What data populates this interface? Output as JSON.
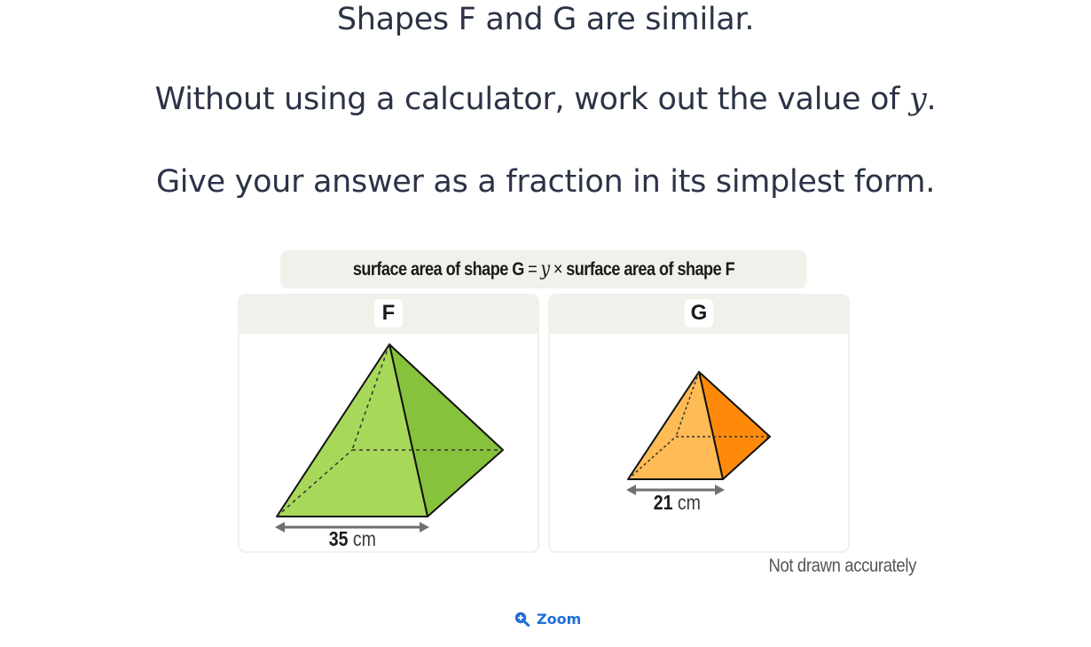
{
  "question": {
    "line1": "Shapes F and G are similar.",
    "line2_prefix": "Without using a calculator, work out the value of ",
    "line2_var": "y",
    "line2_suffix": ".",
    "line3": "Give your answer as a fraction in its simplest form."
  },
  "figure": {
    "formula_left": "surface area of shape G",
    "formula_eq": "=",
    "formula_var": "y",
    "formula_times": "×",
    "formula_right": "surface area of shape F",
    "shape_f": {
      "label": "F",
      "length_value": "35",
      "length_unit": "cm",
      "fill_front": "#a8d85a",
      "fill_side": "#86c23c"
    },
    "shape_g": {
      "label": "G",
      "length_value": "21",
      "length_unit": "cm",
      "fill_front": "#ffbb55",
      "fill_side": "#ff8a0a"
    },
    "note": "Not drawn accurately"
  },
  "zoom": {
    "label": "Zoom",
    "icon": "zoom-in-icon"
  }
}
